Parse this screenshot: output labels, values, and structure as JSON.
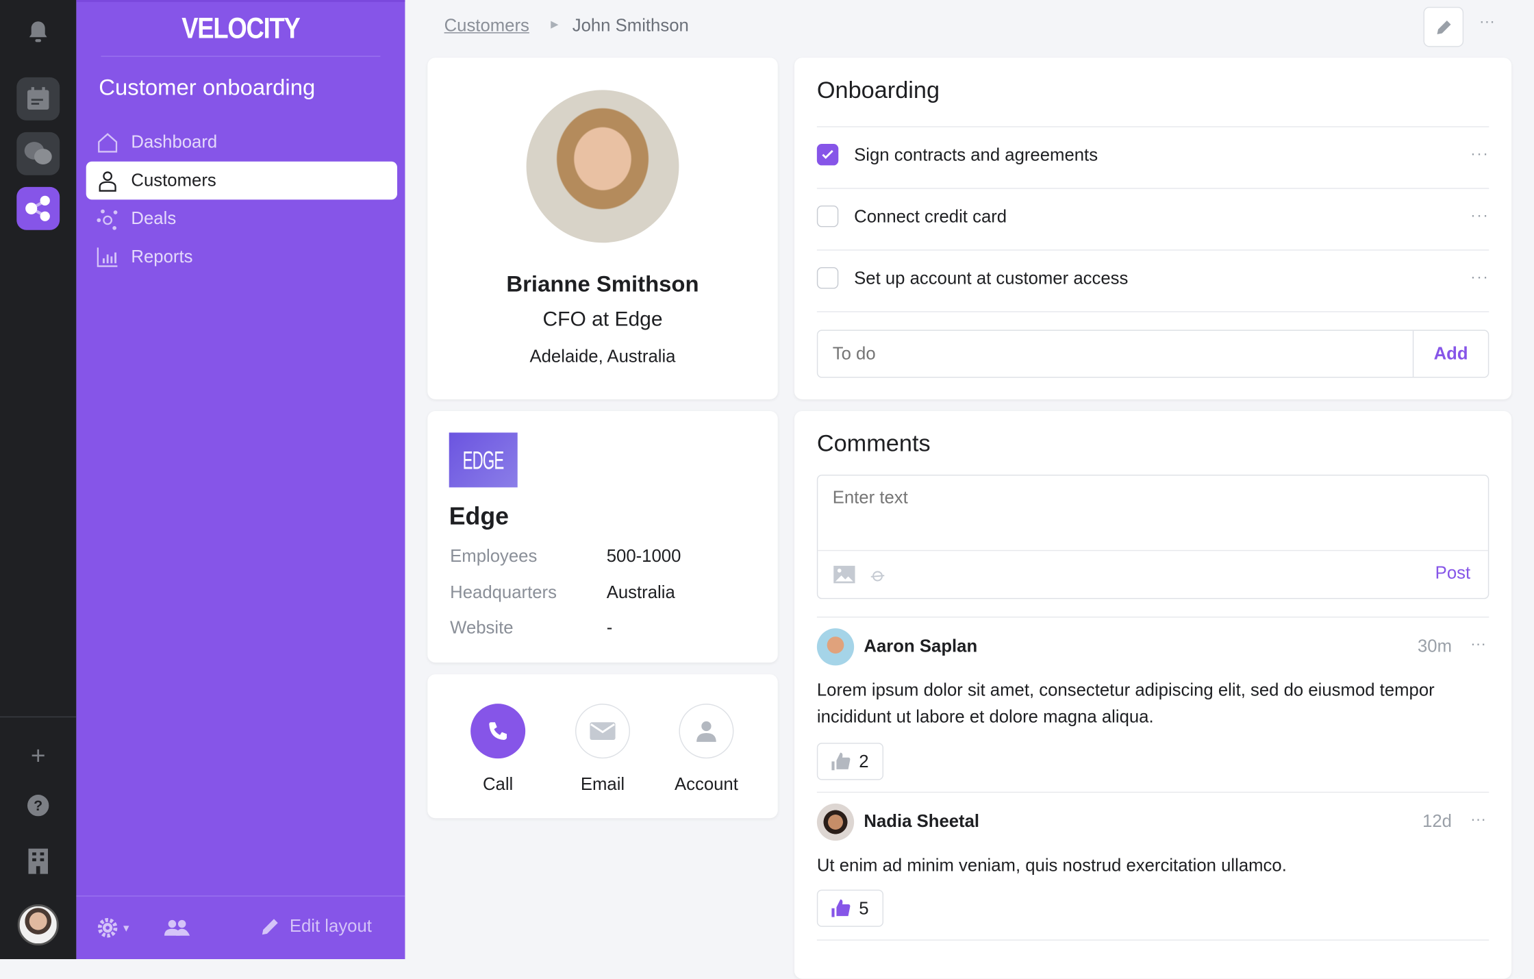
{
  "app": {
    "logo": "VELOCITY",
    "section_title": "Customer onboarding"
  },
  "nav": [
    {
      "label": "Dashboard"
    },
    {
      "label": "Customers"
    },
    {
      "label": "Deals"
    },
    {
      "label": "Reports"
    }
  ],
  "sidebar_footer": {
    "edit_layout": "Edit layout"
  },
  "breadcrumb": {
    "parent": "Customers",
    "current": "John Smithson"
  },
  "profile": {
    "name": "Brianne Smithson",
    "title": "CFO at Edge",
    "location": "Adelaide, Australia"
  },
  "company": {
    "logo_text": "EDGE",
    "name": "Edge",
    "fields": [
      {
        "label": "Employees",
        "value": "500-1000"
      },
      {
        "label": "Headquarters",
        "value": "Australia"
      },
      {
        "label": "Website",
        "value": "-"
      }
    ]
  },
  "actions": [
    {
      "label": "Call"
    },
    {
      "label": "Email"
    },
    {
      "label": "Account"
    }
  ],
  "onboarding": {
    "title": "Onboarding",
    "tasks": [
      {
        "label": "Sign contracts and agreements",
        "done": true
      },
      {
        "label": "Connect credit card",
        "done": false
      },
      {
        "label": "Set up account at customer access",
        "done": false
      }
    ],
    "input_placeholder": "To do",
    "add_label": "Add"
  },
  "comments": {
    "title": "Comments",
    "input_placeholder": "Enter text",
    "post_label": "Post",
    "items": [
      {
        "author": "Aaron Saplan",
        "time": "30m",
        "text": "Lorem ipsum dolor sit amet, consectetur adipiscing elit, sed do eiusmod tempor incididunt ut labore et dolore magna aliqua.",
        "likes": "2",
        "liked": false
      },
      {
        "author": "Nadia Sheetal",
        "time": "12d",
        "text": "Ut enim ad minim veniam, quis nostrud exercitation ullamco.",
        "likes": "5",
        "liked": true
      }
    ]
  },
  "colors": {
    "accent": "#8655e8",
    "rail": "#1f2023",
    "background": "#f4f5f8"
  }
}
